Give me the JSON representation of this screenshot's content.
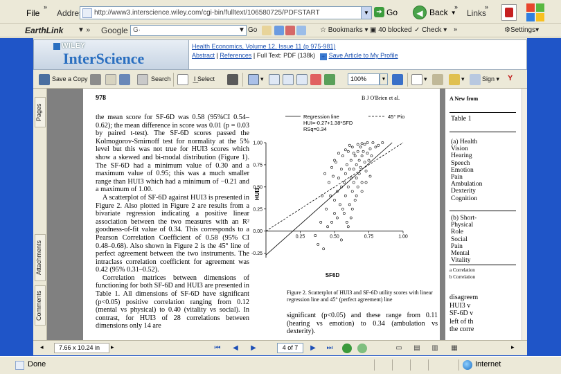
{
  "browser": {
    "menu_file": "File",
    "address_label": "Address",
    "url": "http://www3.interscience.wiley.com/cgi-bin/fulltext/106580725/PDFSTART",
    "go_label": "Go",
    "back_label": "Back",
    "links_label": "Links"
  },
  "toolbar2": {
    "earthlink_label": "EarthLink",
    "google_label": "Google",
    "google_value": "G·",
    "go_label": "Go",
    "bookmarks_label": "Bookmarks",
    "blocked_label": "40 blocked",
    "check_label": "Check",
    "settings_label": "Settings"
  },
  "banner": {
    "wiley": "WILEY",
    "brand": "InterScience",
    "journal": "Health Economics, Volume 12, Issue 11 (p 975-981)",
    "abstract_link": "Abstract",
    "references_link": "References",
    "fulltext_label": "Full Text: PDF (138k)",
    "save_link": "Save Article to My Profile"
  },
  "acrobat_toolbar": {
    "save_copy": "Save a Copy",
    "search": "Search",
    "select": "Select",
    "zoom": "100%",
    "sign": "Sign"
  },
  "side_tabs": {
    "pages": "Pages",
    "attachments": "Attachments",
    "comments": "Comments"
  },
  "page": {
    "number": "978",
    "running_head": "B J O'Brien et al.",
    "body_paragraphs": [
      "the mean score for SF-6D was 0.58 (95%CI 0.54–0.62); the mean difference in score was 0.01 (p = 0.03 by paired t-test). The SF-6D scores passed the Kolmogorov-Smirnoff test for normality at the 5% level but this was not true for HUI3 scores which show a skewed and bi-modal distribution (Figure 1). The SF-6D had a minimum value of 0.30 and a maximum value of 0.95; this was a much smaller range than HUI3 which had a minimum of −0.21 and a maximum of 1.00.",
      "A scatterplot of SF-6D against HUI3 is presented in Figure 2. Also plotted in Figure 2 are results from a bivariate regression indicating a positive linear association between the two measures with an R² goodness-of-fit value of 0.34. This corresponds to a Pearson Correlation Coefficient of 0.58 (95% CI 0.48–0.68). Also shown in Figure 2 is the 45° line of perfect agreement between the two instruments. The intraclass correlation coefficient for agreement was 0.42 (95% 0.31–0.52).",
      "Correlation matrices between dimensions of functioning for both SF-6D and HUI3 are presented in Table 1. All dimensions of SF-6D have significant (p<0.05) positive correlation ranging from 0.12 (mental vs physical) to 0.40 (vitality vs social). In contrast, for HUI3 of 28 correlations between dimensions only 14 are"
    ],
    "figure_caption": "Figure 2. Scatterplot of HUI3 and SF-6D utility scores with linear regression line and 45° (perfect agreement) line",
    "after_text": "significant (p<0.05) and these range from 0.11 (hearing vs emotion) to 0.34 (ambulation vs dexterity)."
  },
  "chart_data": {
    "type": "scatter",
    "title": "",
    "xlabel": "SF6D",
    "ylabel": "HUI3",
    "xlim": [
      0,
      1
    ],
    "ylim": [
      -0.3,
      1
    ],
    "x_ticks": [
      "0.25",
      "0.50",
      "0.75",
      "1.00"
    ],
    "y_ticks": [
      "1.00",
      "0.75",
      "0.50",
      "0.25",
      "0.00",
      "-0.25"
    ],
    "legend": {
      "regression": "Regression line",
      "equation": "HUI=-0.27+1.38*SFD",
      "rsq": "RSq=0.34",
      "fortyfive": "45° Pio"
    },
    "regression": {
      "intercept": -0.27,
      "slope": 1.38
    },
    "points": [
      [
        0.38,
        -0.15
      ],
      [
        0.42,
        -0.2
      ],
      [
        0.45,
        0.05
      ],
      [
        0.48,
        0.1
      ],
      [
        0.5,
        0.2
      ],
      [
        0.5,
        0.35
      ],
      [
        0.52,
        0.15
      ],
      [
        0.52,
        0.45
      ],
      [
        0.53,
        0.6
      ],
      [
        0.54,
        0.3
      ],
      [
        0.55,
        0.5
      ],
      [
        0.55,
        0.7
      ],
      [
        0.56,
        0.25
      ],
      [
        0.56,
        0.85
      ],
      [
        0.57,
        0.55
      ],
      [
        0.58,
        0.4
      ],
      [
        0.58,
        0.65
      ],
      [
        0.59,
        0.75
      ],
      [
        0.6,
        0.5
      ],
      [
        0.6,
        0.9
      ],
      [
        0.61,
        0.3
      ],
      [
        0.61,
        0.7
      ],
      [
        0.62,
        0.6
      ],
      [
        0.62,
        0.8
      ],
      [
        0.63,
        0.45
      ],
      [
        0.63,
        0.95
      ],
      [
        0.64,
        0.7
      ],
      [
        0.64,
        0.55
      ],
      [
        0.65,
        0.85
      ],
      [
        0.65,
        0.35
      ],
      [
        0.66,
        0.75
      ],
      [
        0.66,
        0.6
      ],
      [
        0.67,
        0.9
      ],
      [
        0.67,
        0.5
      ],
      [
        0.68,
        0.8
      ],
      [
        0.68,
        0.65
      ],
      [
        0.69,
        0.95
      ],
      [
        0.69,
        0.72
      ],
      [
        0.7,
        0.85
      ],
      [
        0.7,
        0.55
      ],
      [
        0.71,
        0.9
      ],
      [
        0.72,
        0.78
      ],
      [
        0.72,
        0.98
      ],
      [
        0.73,
        0.68
      ],
      [
        0.74,
        0.88
      ],
      [
        0.74,
        1.0
      ],
      [
        0.75,
        0.8
      ],
      [
        0.76,
        0.93
      ],
      [
        0.77,
        0.85
      ],
      [
        0.78,
        1.0
      ],
      [
        0.8,
        0.95
      ],
      [
        0.82,
        0.97
      ],
      [
        0.85,
        1.0
      ],
      [
        0.47,
        0.4
      ],
      [
        0.44,
        0.25
      ],
      [
        0.4,
        0.1
      ],
      [
        0.36,
        -0.05
      ],
      [
        0.49,
        0.62
      ],
      [
        0.51,
        0.78
      ],
      [
        0.53,
        0.88
      ],
      [
        0.57,
        0.2
      ],
      [
        0.59,
        0.1
      ],
      [
        0.6,
        0.05
      ],
      [
        0.62,
        0.15
      ],
      [
        0.55,
        -0.1
      ],
      [
        0.63,
        0.25
      ],
      [
        0.66,
        0.4
      ],
      [
        0.7,
        0.45
      ],
      [
        0.73,
        0.55
      ],
      [
        0.76,
        0.62
      ],
      [
        0.58,
        0.92
      ],
      [
        0.61,
        0.97
      ],
      [
        0.64,
        0.88
      ],
      [
        0.67,
        0.98
      ],
      [
        0.7,
        0.99
      ],
      [
        0.46,
        0.55
      ],
      [
        0.48,
        0.72
      ],
      [
        0.5,
        0.8
      ],
      [
        0.43,
        0.65
      ],
      [
        0.41,
        0.4
      ]
    ]
  },
  "right_page": {
    "head": "A New from",
    "table_title": "Table 1",
    "list_a": [
      "(a) Health",
      "Vision",
      "Hearing",
      "Speech",
      "Emotion",
      "Pain",
      "Ambulation",
      "Dexterity",
      "Cognition"
    ],
    "list_b": [
      "(b) Short-",
      "Physical",
      "Role",
      "Social",
      "Pain",
      "Mental",
      "Vitality"
    ],
    "foot1": "a Correlation",
    "foot2": "b Correlation",
    "text_lines": [
      "disagreem",
      "HUI3 v",
      "SF-6D v",
      "left of th",
      "the corre"
    ]
  },
  "navbar": {
    "size": "7.66 x 10.24 in",
    "page": "4 of 7"
  },
  "status": {
    "done": "Done",
    "zone": "Internet"
  }
}
